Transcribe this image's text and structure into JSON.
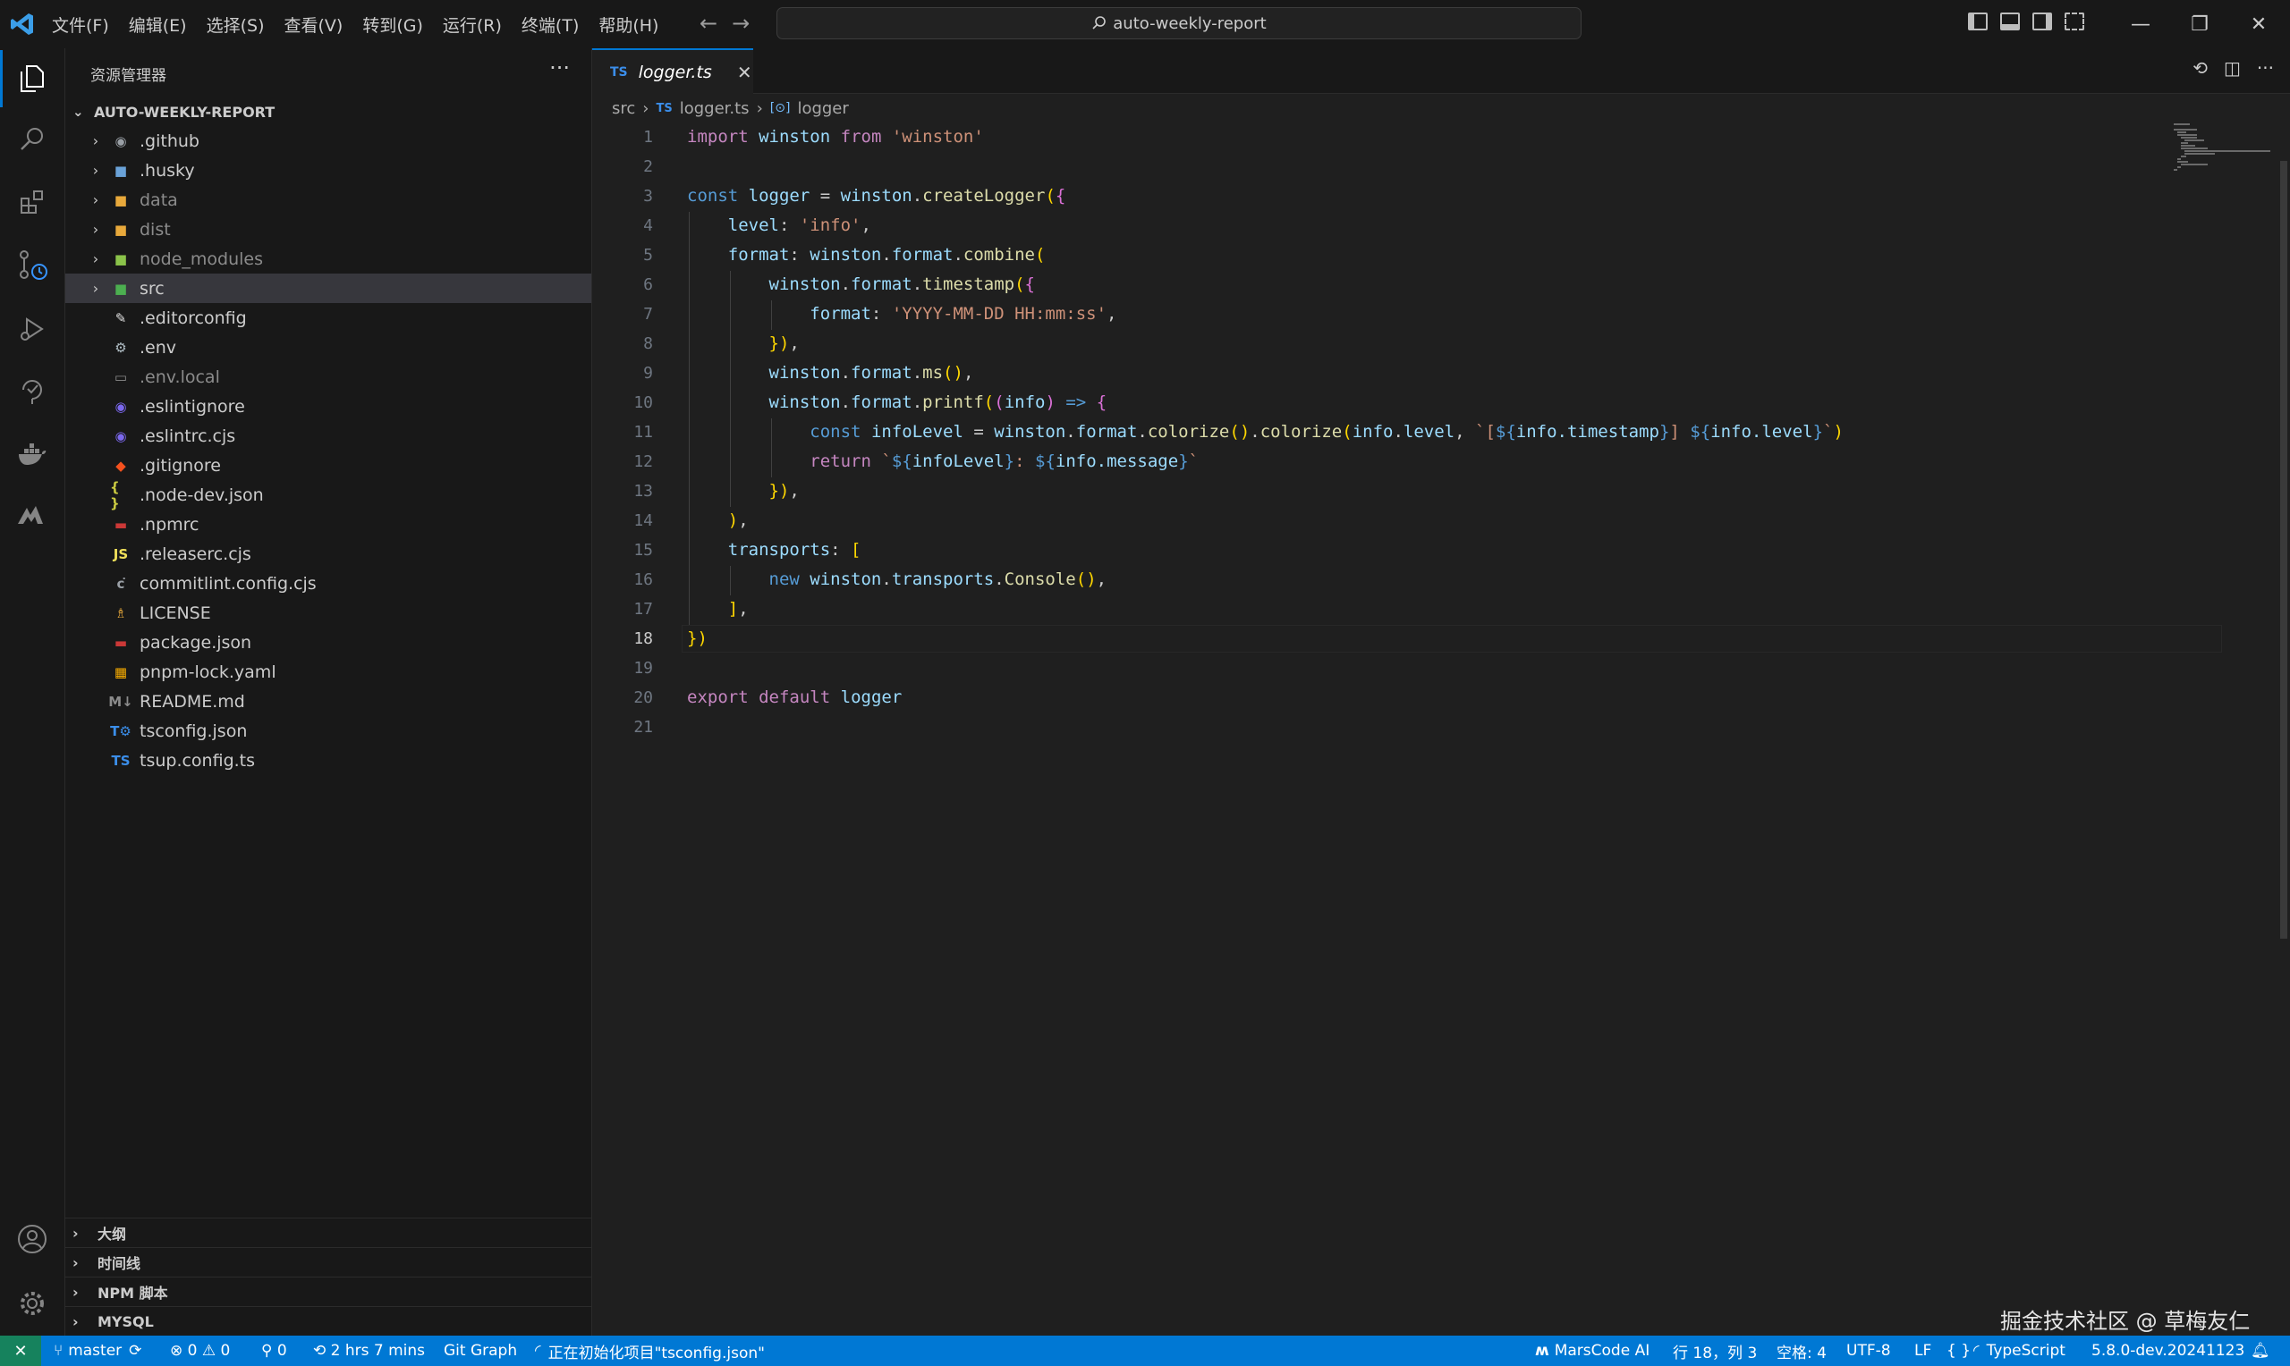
{
  "colors": {
    "accent": "#0078d4",
    "status_bar": "#0078d4",
    "remote_indicator": "#16825d",
    "bg": "#1f1f1f",
    "sidebar_bg": "#181818"
  },
  "menu": [
    "文件(F)",
    "编辑(E)",
    "选择(S)",
    "查看(V)",
    "转到(G)",
    "运行(R)",
    "终端(T)",
    "帮助(H)"
  ],
  "command_center": "auto-weekly-report",
  "sidebar": {
    "title": "资源管理器",
    "more": "···",
    "root": "AUTO-WEEKLY-REPORT",
    "items": [
      {
        "name": ".github",
        "folder": true,
        "icon": "github-folder-icon",
        "icon_text": "◉",
        "icon_color": "#9aa0a6"
      },
      {
        "name": ".husky",
        "folder": true,
        "icon": "husky-folder-icon",
        "icon_text": "■",
        "icon_color": "#6aa2d8"
      },
      {
        "name": "data",
        "folder": true,
        "icon": "folder-icon",
        "icon_text": "■",
        "icon_color": "#e8a93b",
        "dim": true
      },
      {
        "name": "dist",
        "folder": true,
        "icon": "folder-icon",
        "icon_text": "■",
        "icon_color": "#e8a93b",
        "dim": true
      },
      {
        "name": "node_modules",
        "folder": true,
        "icon": "node-folder-icon",
        "icon_text": "■",
        "icon_color": "#8bc34a",
        "dim": true
      },
      {
        "name": "src",
        "folder": true,
        "icon": "src-folder-icon",
        "icon_text": "■",
        "icon_color": "#4caf50",
        "selected": true
      },
      {
        "name": ".editorconfig",
        "icon": "editorconfig-icon",
        "icon_text": "✎",
        "icon_color": "#e0e0e0"
      },
      {
        "name": ".env",
        "icon": "gear-icon",
        "icon_text": "⚙",
        "icon_color": "#b0bec5"
      },
      {
        "name": ".env.local",
        "icon": "terminal-file-icon",
        "icon_text": "▭",
        "icon_color": "#8b8b8b",
        "dim": true
      },
      {
        "name": ".eslintignore",
        "icon": "eslint-icon",
        "icon_text": "◉",
        "icon_color": "#7b68ee"
      },
      {
        "name": ".eslintrc.cjs",
        "icon": "eslint-icon",
        "icon_text": "◉",
        "icon_color": "#7b68ee"
      },
      {
        "name": ".gitignore",
        "icon": "git-icon",
        "icon_text": "◆",
        "icon_color": "#f4511e"
      },
      {
        "name": ".node-dev.json",
        "icon": "json-icon",
        "icon_text": "{ }",
        "icon_color": "#cbcb41"
      },
      {
        "name": ".npmrc",
        "icon": "npm-icon",
        "icon_text": "▬",
        "icon_color": "#cb3837"
      },
      {
        "name": ".releaserc.cjs",
        "icon": "js-icon",
        "icon_text": "JS",
        "icon_color": "#f1e05a"
      },
      {
        "name": "commitlint.config.cjs",
        "icon": "commitlint-icon",
        "icon_text": "c͘",
        "icon_color": "#9aa0a6"
      },
      {
        "name": "LICENSE",
        "icon": "license-icon",
        "icon_text": "♗",
        "icon_color": "#e8a93b"
      },
      {
        "name": "package.json",
        "icon": "npm-icon",
        "icon_text": "▬",
        "icon_color": "#cb3837"
      },
      {
        "name": "pnpm-lock.yaml",
        "icon": "pnpm-icon",
        "icon_text": "▦",
        "icon_color": "#f9ad00"
      },
      {
        "name": "README.md",
        "icon": "markdown-icon",
        "icon_text": "M↓",
        "icon_color": "#8b8b8b"
      },
      {
        "name": "tsconfig.json",
        "icon": "tsconfig-icon",
        "icon_text": "T⚙",
        "icon_color": "#3b8eea"
      },
      {
        "name": "tsup.config.ts",
        "icon": "typescript-icon",
        "icon_text": "TS",
        "icon_color": "#3b8eea"
      }
    ],
    "panels": [
      "大纲",
      "时间线",
      "NPM 脚本",
      "MYSQL"
    ]
  },
  "editor": {
    "tab": {
      "icon": "TS",
      "label": "logger.ts",
      "close": "✕"
    },
    "breadcrumb": {
      "folder": "src",
      "file_icon": "TS",
      "file": "logger.ts",
      "symbol_icon": "[⊙]",
      "symbol": "logger"
    },
    "current_line": 18,
    "lines": [
      "import winston from 'winston'",
      "",
      "const logger = winston.createLogger({",
      "  level: 'info',",
      "  format: winston.format.combine(",
      "    winston.format.timestamp({",
      "      format: 'YYYY-MM-DD HH:mm:ss',",
      "    }),",
      "    winston.format.ms(),",
      "    winston.format.printf((info) => {",
      "      const infoLevel = winston.format.colorize().colorize(info.level, `[${info.timestamp}] ${info.level}`)",
      "      return `${infoLevel}: ${info.message}`",
      "    }),",
      "  ),",
      "  transports: [",
      "    new winston.transports.Console(),",
      "  ],",
      "})",
      "",
      "export default logger",
      ""
    ]
  },
  "status": {
    "remote": "✕",
    "branch": "master",
    "errors": "0",
    "warnings": "0",
    "ports": "0",
    "time": "2 hrs 7 mins",
    "git_graph": "Git Graph",
    "progress": "正在初始化项目\"tsconfig.json\"",
    "marscode": "MarsCode AI",
    "position": "行 18，列 3",
    "spaces": "空格: 4",
    "encoding": "UTF-8",
    "eol": "LF",
    "braces": "{ }",
    "language": "TypeScript",
    "ts_version": "5.8.0-dev.20241123"
  },
  "watermark": "掘金技术社区 @ 草梅友仁"
}
